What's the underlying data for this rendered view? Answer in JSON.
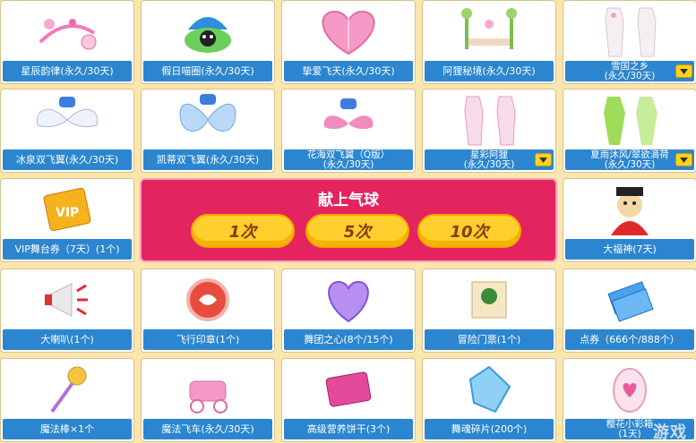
{
  "items": [
    {
      "label": "星辰韵律(永久/30天)",
      "icon": "pink-wand-charm"
    },
    {
      "label": "假日喵圈(永久/30天)",
      "icon": "cat-umbrella-ring"
    },
    {
      "label": "挚爱飞天(永久/30天)",
      "icon": "pink-heart-fan"
    },
    {
      "label": "阿狸秘境(永久/30天)",
      "icon": "garden-swing"
    },
    {
      "label": [
        "雪国之乡",
        "(永久/30天)"
      ],
      "icon": "white-outfit",
      "dropdown": true
    },
    {
      "label": "冰泉双飞翼(永久/30天)",
      "icon": "white-wings-badge"
    },
    {
      "label": "凯蒂双飞翼(永久/30天)",
      "icon": "blue-butterfly-wings"
    },
    {
      "label": [
        "花海双飞翼（Q版）",
        "(永久/30天)"
      ],
      "icon": "pink-small-wings"
    },
    {
      "label": [
        "星彩阿狸",
        "(永久/30天)"
      ],
      "icon": "pink-outfit",
      "dropdown": true
    },
    {
      "label": [
        "夏雨沐风/翠欲滴荷",
        "(永久/30天)"
      ],
      "icon": "green-outfit",
      "dropdown": true
    },
    {
      "label": "VIP舞台券（7天）(1个)",
      "icon": "vip-ticket"
    },
    {
      "label": "大福神(7天)",
      "icon": "fortune-god"
    },
    {
      "label": "大喇叭(1个)",
      "icon": "megaphone"
    },
    {
      "label": "飞行印章(1个)",
      "icon": "red-seal"
    },
    {
      "label": "舞团之心(8个/15个)",
      "icon": "purple-heart"
    },
    {
      "label": "冒险门票(1个)",
      "icon": "scroll-ticket"
    },
    {
      "label": "点券（666个/888个）",
      "icon": "blue-coupons"
    },
    {
      "label": "魔法棒×1个",
      "icon": "magic-wand"
    },
    {
      "label": "魔法飞车(永久/30天)",
      "icon": "pink-carriage"
    },
    {
      "label": "高级营养饼干(3个)",
      "icon": "biscuit-pack"
    },
    {
      "label": "舞魂碎片(200个)",
      "icon": "blue-crystal"
    },
    {
      "label": [
        "樱花小彩箱",
        "(1天)"
      ],
      "icon": "love-egg"
    }
  ],
  "panel": {
    "title": "献上气球",
    "options": [
      "1次",
      "5次",
      "10次"
    ]
  },
  "watermark": "游戏",
  "colors": {
    "background": "#fbe6ae",
    "label_bar": "#2b86cf",
    "panel": "#e3245f",
    "button": "#ffcf2e"
  }
}
